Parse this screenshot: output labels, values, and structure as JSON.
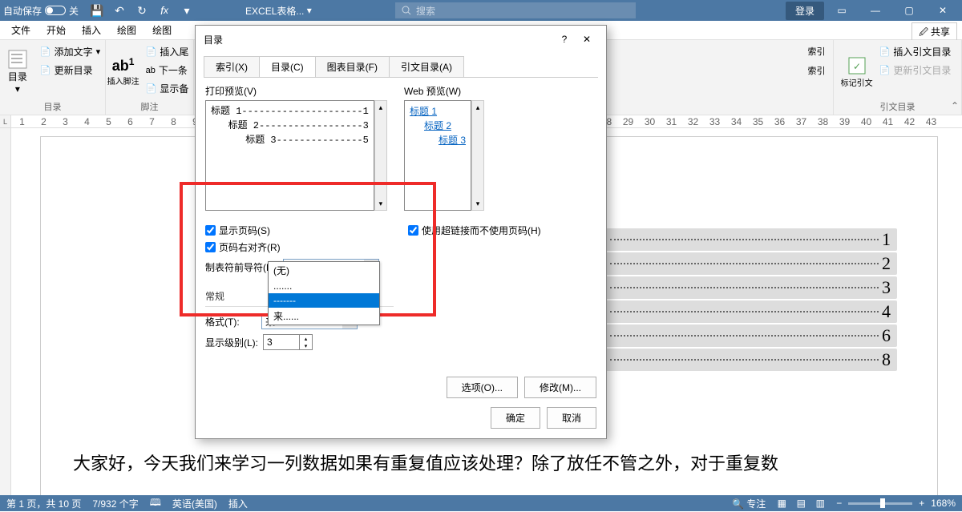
{
  "titlebar": {
    "auto_save": "自动保存",
    "auto_save_state": "关",
    "doc_title": "EXCEL表格...",
    "search_placeholder": "搜索",
    "login": "登录"
  },
  "ribbon_tabs": [
    "文件",
    "开始",
    "插入",
    "绘图",
    "绘图"
  ],
  "share": "共享",
  "ribbon": {
    "toc": {
      "label": "目录",
      "btn": "目录",
      "add_text": "添加文字",
      "update": "更新目录"
    },
    "footnote": {
      "label": "脚注",
      "insert": "插入脚注",
      "insert2": "插入尾",
      "next": "下一条",
      "show": "显示备"
    },
    "index": {
      "label": "索引",
      "item1": "索引",
      "item2": "索引"
    },
    "mark": {
      "label": "引文目录",
      "btn": "标记引文",
      "insert": "插入引文目录",
      "update": "更新引文目录"
    }
  },
  "dialog": {
    "title": "目录",
    "tabs": [
      "索引(X)",
      "目录(C)",
      "图表目录(F)",
      "引文目录(A)"
    ],
    "print_preview_label": "打印预览(V)",
    "web_preview_label": "Web 预览(W)",
    "print_preview_lines": [
      "标题 1---------------------1",
      "   标题 2------------------3",
      "      标题 3---------------5"
    ],
    "web_preview_lines": [
      "标题 1",
      "标题 2",
      "标题 3"
    ],
    "show_pagenum": "显示页码(S)",
    "right_align": "页码右对齐(R)",
    "use_hyperlinks": "使用超链接而不使用页码(H)",
    "leader_label": "制表符前导符(B):",
    "leader_value": "-------",
    "leader_options": [
      "(无)",
      ".......",
      "-------",
      "来......"
    ],
    "general": "常规",
    "format_label": "格式(T):",
    "format_value": "来......",
    "levels_label": "显示级别(L):",
    "levels": "3",
    "options_btn": "选项(O)...",
    "modify_btn": "修改(M)...",
    "ok": "确定",
    "cancel": "取消"
  },
  "doc_toc_items": [
    {
      "num": "1"
    },
    {
      "num": "2"
    },
    {
      "num": "3"
    },
    {
      "num": "4"
    },
    {
      "num": "6"
    },
    {
      "num": "8"
    }
  ],
  "doc_body": "大家好，今天我们来学习一列数据如果有重复值应该处理？除了放任不管之外，对于重复数",
  "status": {
    "page": "第 1 页，共 10 页",
    "words": "7/932 个字",
    "lang": "英语(美国)",
    "mode": "插入",
    "focus": "专注",
    "zoom": "168%"
  }
}
